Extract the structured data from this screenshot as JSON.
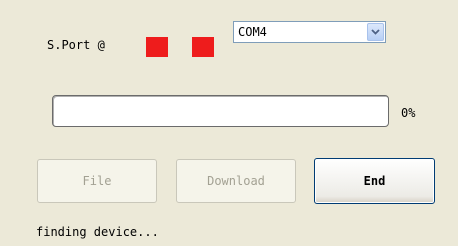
{
  "port": {
    "label": "S.Port @",
    "led_color": "#ee1c1c",
    "selected": "COM4"
  },
  "progress": {
    "value": 0,
    "label": "0%"
  },
  "buttons": {
    "file_label": "File",
    "download_label": "Download",
    "end_label": "End"
  },
  "status_text": "finding device..."
}
